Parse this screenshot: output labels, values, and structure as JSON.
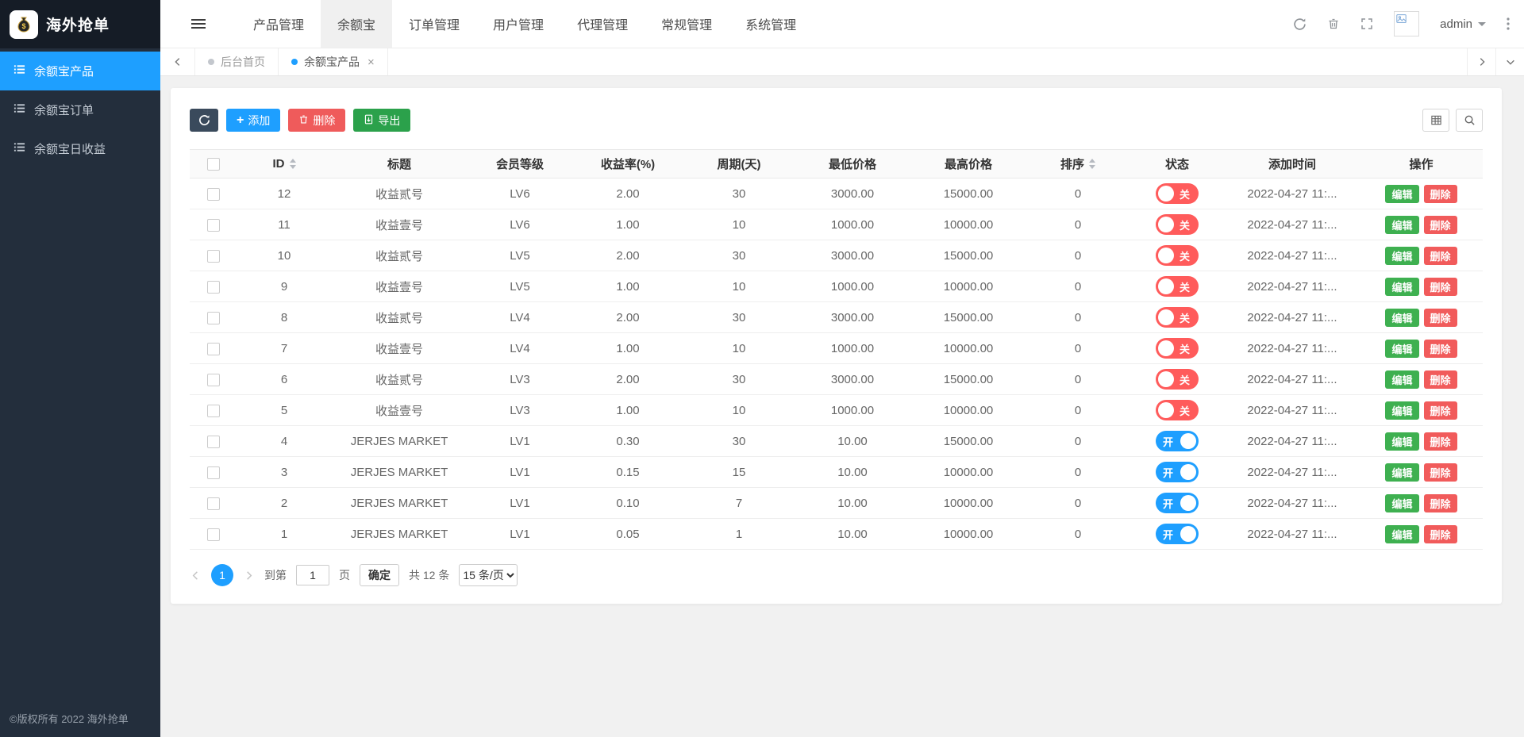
{
  "app": {
    "logo_text": "海外抢单",
    "copyright": "©版权所有 2022 海外抢单"
  },
  "topnav": {
    "items": [
      {
        "label": "产品管理",
        "active": false
      },
      {
        "label": "余额宝",
        "active": true
      },
      {
        "label": "订单管理",
        "active": false
      },
      {
        "label": "用户管理",
        "active": false
      },
      {
        "label": "代理管理",
        "active": false
      },
      {
        "label": "常规管理",
        "active": false
      },
      {
        "label": "系统管理",
        "active": false
      }
    ],
    "user": "admin"
  },
  "sidebar": {
    "items": [
      {
        "label": "余额宝产品",
        "active": true
      },
      {
        "label": "余额宝订单",
        "active": false
      },
      {
        "label": "余额宝日收益",
        "active": false
      }
    ]
  },
  "tabs": [
    {
      "label": "后台首页",
      "active": false
    },
    {
      "label": "余额宝产品",
      "active": true,
      "close_glyph": "×"
    }
  ],
  "toolbar": {
    "add_icon": "+",
    "add_label": "添加",
    "delete_label": "删除",
    "export_label": "导出"
  },
  "table": {
    "columns": [
      "ID",
      "标题",
      "会员等级",
      "收益率(%)",
      "周期(天)",
      "最低价格",
      "最高价格",
      "排序",
      "状态",
      "添加时间",
      "操作"
    ],
    "status_on": "开",
    "status_off": "关",
    "edit_label": "编辑",
    "delete_label": "删除",
    "rows": [
      {
        "id": "12",
        "title": "收益贰号",
        "level": "LV6",
        "rate": "2.00",
        "cycle": "30",
        "min": "3000.00",
        "max": "15000.00",
        "sort": "0",
        "status": "off",
        "time": "2022-04-27 11:..."
      },
      {
        "id": "11",
        "title": "收益壹号",
        "level": "LV6",
        "rate": "1.00",
        "cycle": "10",
        "min": "1000.00",
        "max": "10000.00",
        "sort": "0",
        "status": "off",
        "time": "2022-04-27 11:..."
      },
      {
        "id": "10",
        "title": "收益贰号",
        "level": "LV5",
        "rate": "2.00",
        "cycle": "30",
        "min": "3000.00",
        "max": "15000.00",
        "sort": "0",
        "status": "off",
        "time": "2022-04-27 11:..."
      },
      {
        "id": "9",
        "title": "收益壹号",
        "level": "LV5",
        "rate": "1.00",
        "cycle": "10",
        "min": "1000.00",
        "max": "10000.00",
        "sort": "0",
        "status": "off",
        "time": "2022-04-27 11:..."
      },
      {
        "id": "8",
        "title": "收益贰号",
        "level": "LV4",
        "rate": "2.00",
        "cycle": "30",
        "min": "3000.00",
        "max": "15000.00",
        "sort": "0",
        "status": "off",
        "time": "2022-04-27 11:..."
      },
      {
        "id": "7",
        "title": "收益壹号",
        "level": "LV4",
        "rate": "1.00",
        "cycle": "10",
        "min": "1000.00",
        "max": "10000.00",
        "sort": "0",
        "status": "off",
        "time": "2022-04-27 11:..."
      },
      {
        "id": "6",
        "title": "收益贰号",
        "level": "LV3",
        "rate": "2.00",
        "cycle": "30",
        "min": "3000.00",
        "max": "15000.00",
        "sort": "0",
        "status": "off",
        "time": "2022-04-27 11:..."
      },
      {
        "id": "5",
        "title": "收益壹号",
        "level": "LV3",
        "rate": "1.00",
        "cycle": "10",
        "min": "1000.00",
        "max": "10000.00",
        "sort": "0",
        "status": "off",
        "time": "2022-04-27 11:..."
      },
      {
        "id": "4",
        "title": "JERJES MARKET",
        "level": "LV1",
        "rate": "0.30",
        "cycle": "30",
        "min": "10.00",
        "max": "15000.00",
        "sort": "0",
        "status": "on",
        "time": "2022-04-27 11:..."
      },
      {
        "id": "3",
        "title": "JERJES MARKET",
        "level": "LV1",
        "rate": "0.15",
        "cycle": "15",
        "min": "10.00",
        "max": "10000.00",
        "sort": "0",
        "status": "on",
        "time": "2022-04-27 11:..."
      },
      {
        "id": "2",
        "title": "JERJES MARKET",
        "level": "LV1",
        "rate": "0.10",
        "cycle": "7",
        "min": "10.00",
        "max": "10000.00",
        "sort": "0",
        "status": "on",
        "time": "2022-04-27 11:..."
      },
      {
        "id": "1",
        "title": "JERJES MARKET",
        "level": "LV1",
        "rate": "0.05",
        "cycle": "1",
        "min": "10.00",
        "max": "10000.00",
        "sort": "0",
        "status": "on",
        "time": "2022-04-27 11:..."
      }
    ]
  },
  "pagination": {
    "page": "1",
    "goto_prefix": "到第",
    "goto_value": "1",
    "goto_suffix": "页",
    "confirm_label": "确定",
    "total_label": "共 12 条",
    "per_page": "15 条/页"
  },
  "icons": {
    "money-bag-icon": "money-bag-with-$",
    "menu-toggle-icon": "hamburger-lines",
    "list-icon": "list-lines",
    "refresh-icon": "circular-arrow",
    "trash-icon": "trash-can",
    "fullscreen-icon": "expand-arrows",
    "caret-down-icon": "triangle-down",
    "more-vert-icon": "vertical-dots",
    "chevron-left-icon": "‹",
    "chevron-right-icon": "›",
    "chevron-down-icon": "⌄",
    "plus-icon": "+",
    "export-icon": "file-with-arrow",
    "grid-icon": "table-grid",
    "search-icon": "magnifier",
    "sort-icon": "up-down-carets",
    "tab-dot-icon": "circle"
  },
  "colors": {
    "primary": "#1e9fff",
    "sidebar_bg": "#232e3c",
    "logo_bg": "#151c26",
    "danger": "#ef5b5b",
    "success": "#2ba14b",
    "edit_green": "#3eb050",
    "toggle_off": "#ff5b5b",
    "toggle_on": "#1e9fff",
    "dark_button": "#3a4a5c",
    "content_bg": "#f1f1f1"
  }
}
